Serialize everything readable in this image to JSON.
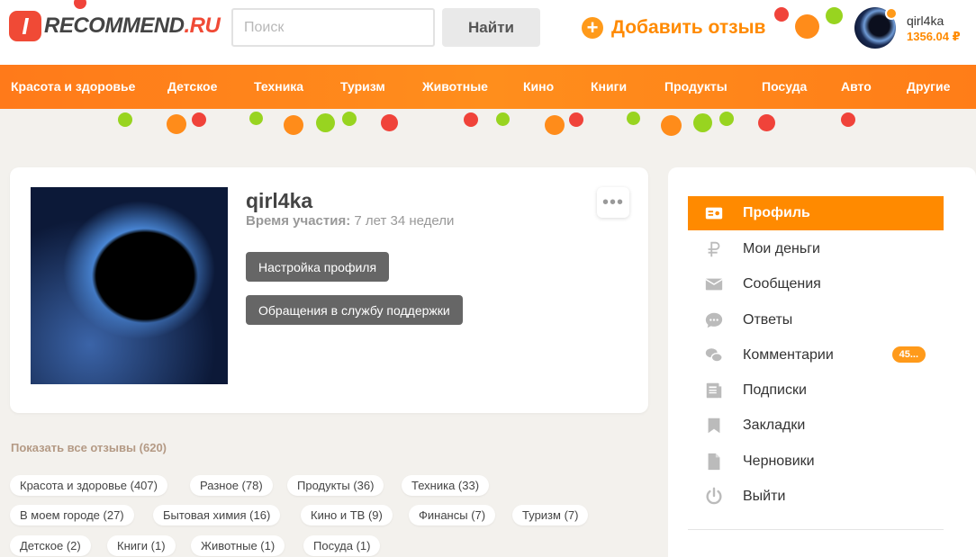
{
  "header": {
    "logo_badge": "I",
    "logo_main": "RECOMMEND",
    "logo_suffix": ".RU",
    "search_placeholder": "Поиск",
    "search_button": "Найти",
    "add_review": "Добавить отзыв",
    "user_name": "qirl4ka",
    "user_balance": "1356.04 ₽"
  },
  "nav": [
    "Красота и здоровье",
    "Детское",
    "Техника",
    "Туризм",
    "Животные",
    "Кино",
    "Книги",
    "Продукты",
    "Посуда",
    "Авто",
    "Другие"
  ],
  "profile": {
    "name": "qirl4ka",
    "membership_label": "Время участия:",
    "membership_value": "7 лет 34 недели",
    "settings_button": "Настройка профиля",
    "support_button": "Обращения в службу поддержки",
    "more_icon": "•••"
  },
  "reviews": {
    "show_all": "Показать все отзывы (620)",
    "tags": [
      "Красота и здоровье (407)",
      "Разное (78)",
      "Продукты (36)",
      "Техника (33)",
      "В моем городе (27)",
      "Бытовая химия (16)",
      "Кино и ТВ (9)",
      "Финансы (7)",
      "Туризм (7)",
      "Детское (2)",
      "Книги (1)",
      "Животные (1)",
      "Посуда (1)"
    ]
  },
  "sidebar": {
    "items": [
      {
        "label": "Профиль",
        "icon": "profile-card-icon"
      },
      {
        "label": "Мои деньги",
        "icon": "ruble-icon"
      },
      {
        "label": "Сообщения",
        "icon": "envelope-icon"
      },
      {
        "label": "Ответы",
        "icon": "chat-bubble-icon"
      },
      {
        "label": "Комментарии",
        "icon": "comments-icon",
        "badge": "45..."
      },
      {
        "label": "Подписки",
        "icon": "newspaper-icon"
      },
      {
        "label": "Закладки",
        "icon": "bookmark-icon"
      },
      {
        "label": "Черновики",
        "icon": "document-icon"
      },
      {
        "label": "Выйти",
        "icon": "power-icon"
      }
    ]
  },
  "colors": {
    "accent": "#ff8a00",
    "brand_red": "#f04a36",
    "background": "#f3f1ed"
  }
}
